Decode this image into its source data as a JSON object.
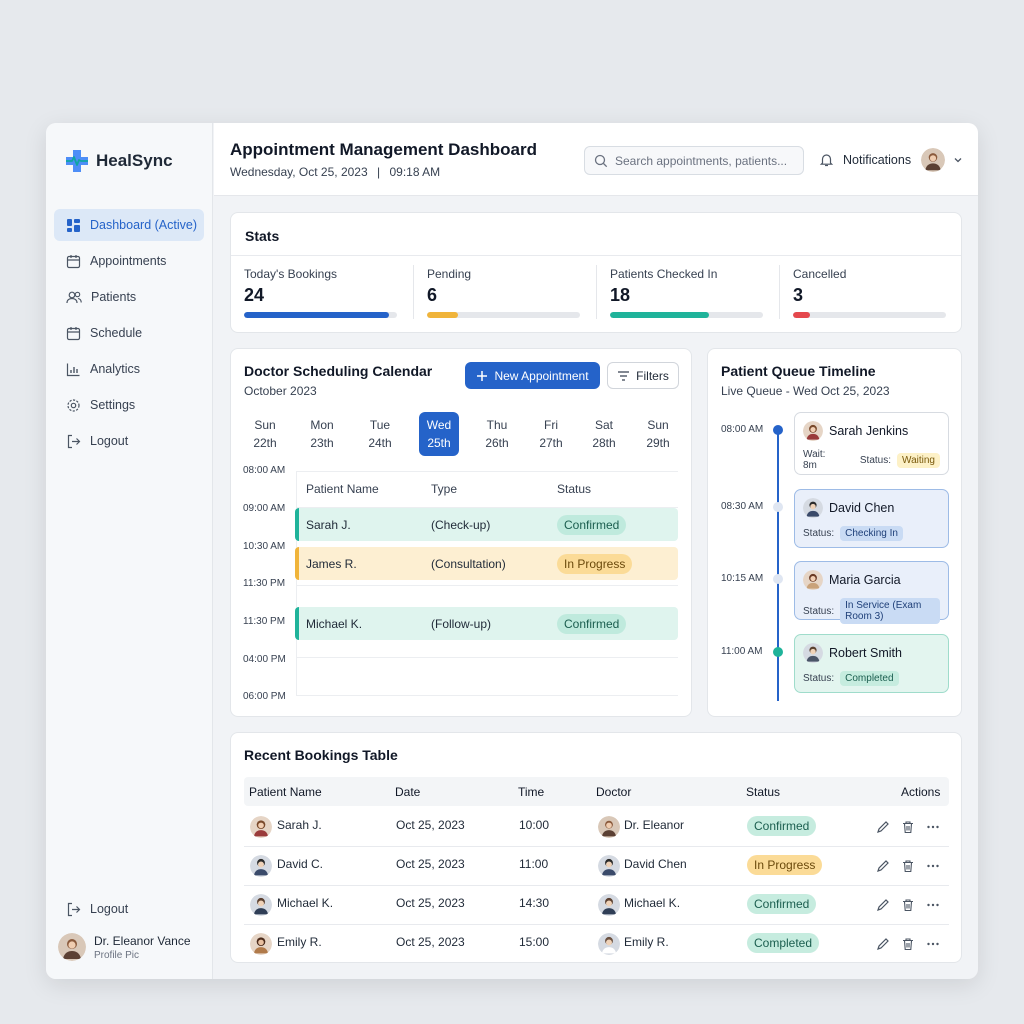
{
  "app": {
    "name": "HealSync"
  },
  "sidebar": {
    "items": [
      {
        "label": "Dashboard (Active)",
        "icon": "dashboard-icon",
        "active": true
      },
      {
        "label": "Appointments",
        "icon": "calendar-icon"
      },
      {
        "label": "Patients",
        "icon": "users-icon"
      },
      {
        "label": "Schedule",
        "icon": "calendar-icon"
      },
      {
        "label": "Analytics",
        "icon": "chart-icon"
      },
      {
        "label": "Settings",
        "icon": "gear-icon"
      },
      {
        "label": "Logout",
        "icon": "logout-icon"
      }
    ],
    "bottom_logout": "Logout",
    "profile": {
      "name": "Dr. Eleanor Vance",
      "subtitle": "Profile Pic"
    }
  },
  "header": {
    "title": "Appointment Management Dashboard",
    "date": "Wednesday, Oct 25, 2023",
    "time": "09:18 AM",
    "search_placeholder": "Search appointments, patients...",
    "notifications_label": "Notifications"
  },
  "stats": {
    "title": "Stats",
    "items": [
      {
        "label": "Today's Bookings",
        "value": "24",
        "progress": 0.95,
        "color": "#2563c9"
      },
      {
        "label": "Pending",
        "value": "6",
        "progress": 0.2,
        "color": "#f0b43a"
      },
      {
        "label": "Patients Checked In",
        "value": "18",
        "progress": 0.65,
        "color": "#1fb39a"
      },
      {
        "label": "Cancelled",
        "value": "3",
        "progress": 0.11,
        "color": "#e5484d"
      }
    ]
  },
  "calendar": {
    "title": "Doctor Scheduling Calendar",
    "month": "October 2023",
    "new_button": "New Appointment",
    "filters_button": "Filters",
    "days": [
      {
        "dow": "Sun",
        "date": "22th"
      },
      {
        "dow": "Mon",
        "date": "23th"
      },
      {
        "dow": "Tue",
        "date": "24th"
      },
      {
        "dow": "Wed",
        "date": "25th",
        "active": true
      },
      {
        "dow": "Thu",
        "date": "26th"
      },
      {
        "dow": "Fri",
        "date": "27th"
      },
      {
        "dow": "Sat",
        "date": "28th"
      },
      {
        "dow": "Sun",
        "date": "29th"
      }
    ],
    "times": [
      "08:00 AM",
      "09:00 AM",
      "10:30 AM",
      "11:30 PM",
      "11:30 PM",
      "04:00 PM",
      "06:00 PM"
    ],
    "columns": [
      "Patient Name",
      "Type",
      "Status"
    ],
    "appointments": [
      {
        "patient": "Sarah J.",
        "type": "(Check-up)",
        "status": "Confirmed",
        "kind": "confirmed"
      },
      {
        "patient": "James R.",
        "type": "(Consultation)",
        "status": "In Progress",
        "kind": "progress"
      },
      {
        "patient": "Michael K.",
        "type": "(Follow-up)",
        "status": "Confirmed",
        "kind": "confirmed"
      }
    ]
  },
  "queue": {
    "title": "Patient Queue Timeline",
    "subtitle": "Live Queue - Wed Oct 25, 2023",
    "entries": [
      {
        "time": "08:00 AM",
        "name": "Sarah Jenkins",
        "wait": "Wait: 8m",
        "status_label": "Status:",
        "status": "Waiting"
      },
      {
        "time": "08:30 AM",
        "name": "David Chen",
        "status_label": "Status:",
        "status": "Checking In"
      },
      {
        "time": "10:15 AM",
        "name": "Maria Garcia",
        "status_label": "Status:",
        "status": "In Service (Exam Room 3)"
      },
      {
        "time": "11:00 AM",
        "name": "Robert Smith",
        "status_label": "Status:",
        "status": "Completed"
      }
    ]
  },
  "bookings": {
    "title": "Recent Bookings Table",
    "columns": [
      "Patient Name",
      "Date",
      "Time",
      "Doctor",
      "Status",
      "Actions"
    ],
    "rows": [
      {
        "patient": "Sarah J.",
        "date": "Oct 25, 2023",
        "time": "10:00",
        "doctor": "Dr. Eleanor",
        "status": "Confirmed",
        "kind": "confirmed"
      },
      {
        "patient": "David C.",
        "date": "Oct 25, 2023",
        "time": "11:00",
        "doctor": "David Chen",
        "status": "In Progress",
        "kind": "progress"
      },
      {
        "patient": "Michael K.",
        "date": "Oct 25, 2023",
        "time": "14:30",
        "doctor": "Michael K.",
        "status": "Confirmed",
        "kind": "confirmed"
      },
      {
        "patient": "Emily R.",
        "date": "Oct 25, 2023",
        "time": "15:00",
        "doctor": "Emily R.",
        "status": "Completed",
        "kind": "completed"
      }
    ]
  },
  "colors": {
    "accent": "#2563c9",
    "confirmed_bg": "#d7f2ea",
    "progress_bg": "#fdecc8",
    "waiting_bg": "#fdf1c7"
  }
}
